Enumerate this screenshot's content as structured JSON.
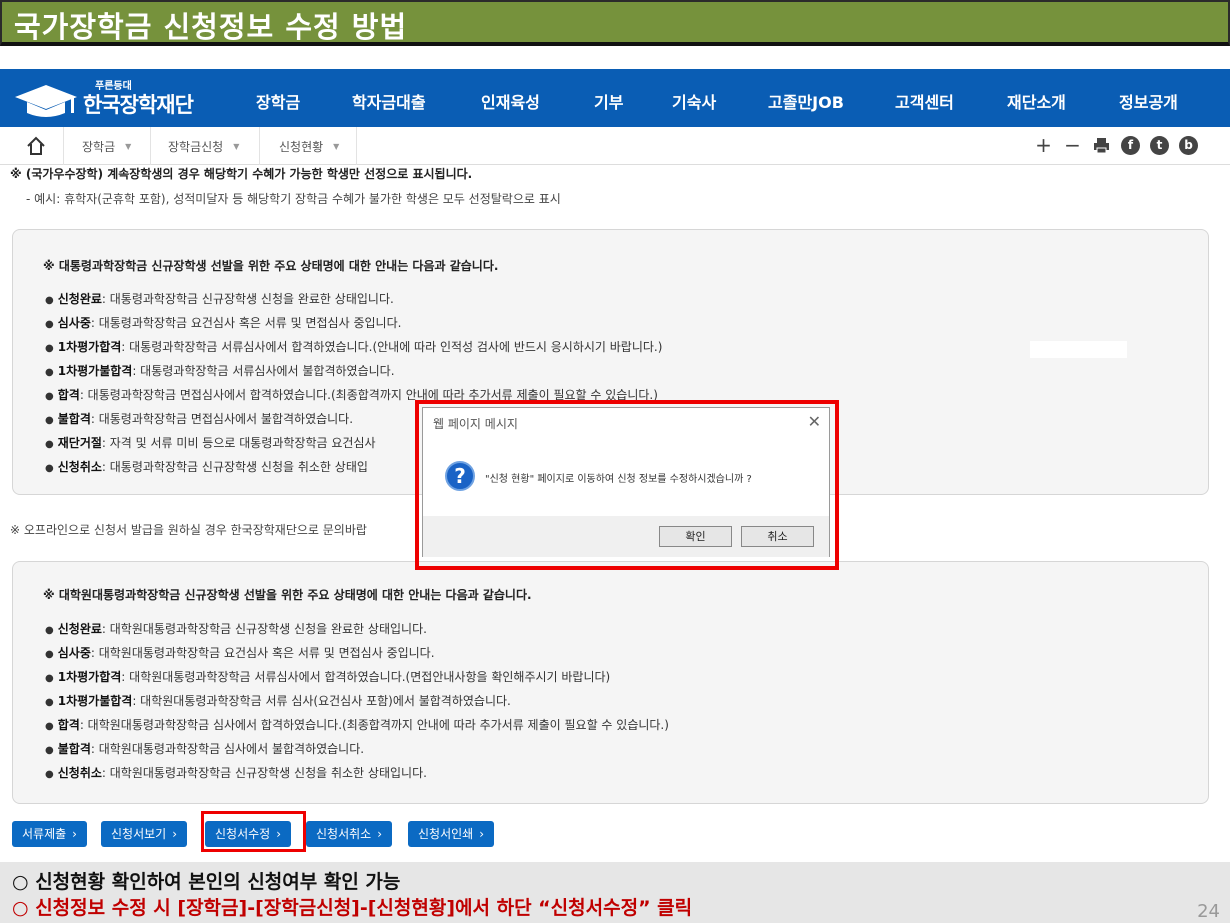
{
  "slide_title": "국가장학금 신청정보 수정 방법",
  "header": {
    "logo_slogan": "푸른등대",
    "logo_name": "한국장학재단",
    "nav": [
      "장학금",
      "학자금대출",
      "인재육성",
      "기부",
      "기숙사",
      "고졸만JOB",
      "고객센터",
      "재단소개",
      "정보공개"
    ]
  },
  "breadcrumb": {
    "items": [
      "장학금",
      "장학금신청",
      "신청현황"
    ],
    "tools": [
      "+",
      "−",
      "print-icon",
      "facebook-icon",
      "twitter-icon",
      "blog-icon"
    ],
    "tool_letters": {
      "facebook": "f",
      "twitter": "t",
      "blog": "b"
    }
  },
  "notes": {
    "line1": "※ (국가우수장학) 계속장학생의 경우 해당학기 수혜가 가능한 학생만 선정으로 표시됩니다.",
    "line2": "- 예시: 휴학자(군휴학 포함), 성적미달자 등 해당학기 장학금 수혜가 불가한 학생은 모두 선정탈락으로 표시"
  },
  "box1": {
    "heading": "※ 대통령과학장학금 신규장학생 선발을 위한 주요 상태명에 대한 안내는 다음과 같습니다.",
    "items": [
      {
        "term": "신청완료",
        "desc": ": 대통령과학장학금 신규장학생 신청을 완료한 상태입니다."
      },
      {
        "term": "심사중",
        "desc": ": 대통령과학장학금 요건심사 혹은 서류 및 면접심사 중입니다."
      },
      {
        "term": "1차평가합격",
        "desc": ": 대통령과학장학금 서류심사에서 합격하였습니다.(안내에 따라 인적성 검사에 반드시 응시하시기 바랍니다.)"
      },
      {
        "term": "1차평가불합격",
        "desc": ": 대통령과학장학금 서류심사에서 불합격하였습니다."
      },
      {
        "term": "합격",
        "desc": ": 대통령과학장학금 면접심사에서 합격하였습니다.(최종합격까지 안내에 따라 추가서류 제출이 필요할 수 있습니다.)"
      },
      {
        "term": "불합격",
        "desc": ": 대통령과학장학금 면접심사에서 불합격하였습니다."
      },
      {
        "term": "재단거절",
        "desc": ": 자격 및 서류 미비 등으로 대통령과학장학금 요건심사"
      },
      {
        "term": "신청취소",
        "desc": ": 대통령과학장학금 신규장학생 신청을 취소한 상태입"
      }
    ]
  },
  "offline_note": "※ 오프라인으로 신청서 발급을 원하실 경우 한국장학재단으로 문의바랍",
  "box2": {
    "heading": "※ 대학원대통령과학장학금 신규장학생 선발을 위한 주요 상태명에 대한 안내는 다음과 같습니다.",
    "items": [
      {
        "term": "신청완료",
        "desc": ": 대학원대통령과학장학금 신규장학생 신청을 완료한 상태입니다."
      },
      {
        "term": "심사중",
        "desc": ": 대학원대통령과학장학금 요건심사 혹은 서류 및 면접심사 중입니다."
      },
      {
        "term": "1차평가합격",
        "desc": ": 대학원대통령과학장학금 서류심사에서 합격하였습니다.(면접안내사항을 확인해주시기 바랍니다)"
      },
      {
        "term": "1차평가불합격",
        "desc": ": 대학원대통령과학장학금 서류 심사(요건심사 포함)에서 불합격하였습니다."
      },
      {
        "term": "합격",
        "desc": ": 대학원대통령과학장학금 심사에서 합격하였습니다.(최종합격까지 안내에 따라 추가서류 제출이 필요할 수 있습니다.)"
      },
      {
        "term": "불합격",
        "desc": ": 대학원대통령과학장학금 심사에서 불합격하였습니다."
      },
      {
        "term": "신청취소",
        "desc": ": 대학원대통령과학장학금 신규장학생 신청을 취소한 상태입니다."
      }
    ]
  },
  "buttons": [
    "서류제출",
    "신청서보기",
    "신청서수정",
    "신청서취소",
    "신청서인쇄"
  ],
  "button_arrow": "›",
  "dialog": {
    "title": "웹 페이지 메시지",
    "close": "✕",
    "icon": "?",
    "message": "\"신청 현황\" 페이지로 이동하여 신청 정보를 수정하시겠습니까 ?",
    "ok": "확인",
    "cancel": "취소"
  },
  "footer": {
    "line1": "○ 신청현황 확인하여 본인의 신청여부 확인 가능",
    "line2": "○ 신청정보 수정 시 [장학금]-[장학금신청]-[신청현황]에서 하단 “신청서수정” 클릭",
    "page": "24"
  },
  "colors": {
    "nav_bg": "#0a5db4",
    "title_bg": "#76923c",
    "highlight": "#e00000",
    "button_bg": "#0b6ac3",
    "footer_red": "#c00000"
  }
}
